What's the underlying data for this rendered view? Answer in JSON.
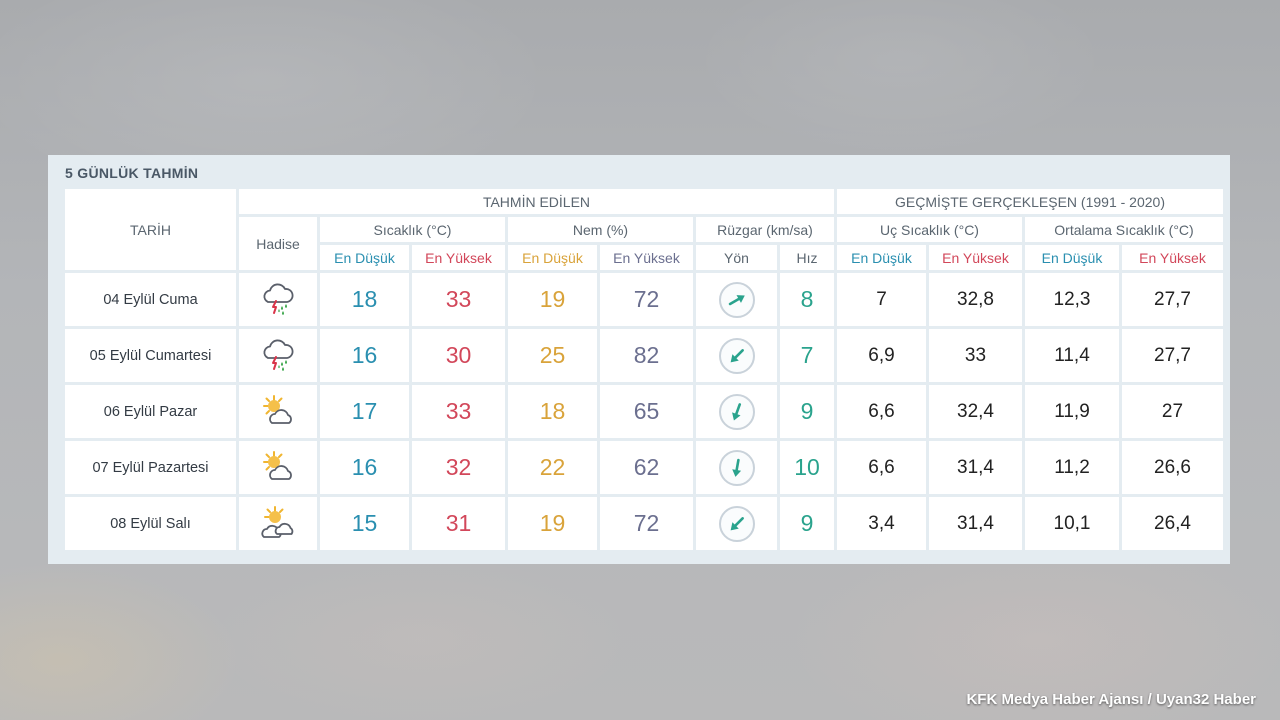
{
  "panel": {
    "title": "5 GÜNLÜK TAHMİN"
  },
  "header": {
    "date_col": "TARİH",
    "forecast_group": "TAHMİN EDİLEN",
    "history_group": "GEÇMİŞTE GERÇEKLEŞEN (1991 - 2020)",
    "event": "Hadise",
    "temperature": "Sıcaklık (°C)",
    "humidity": "Nem (%)",
    "wind": "Rüzgar (km/sa)",
    "extreme_temp": "Uç Sıcaklık (°C)",
    "average_temp": "Ortalama Sıcaklık (°C)",
    "low": "En Düşük",
    "high": "En Yüksek",
    "direction": "Yön",
    "speed": "Hız"
  },
  "rows": [
    {
      "date": "04 Eylül Cuma",
      "icon": "thunderstorm-rain-icon",
      "temp_low": "18",
      "temp_high": "33",
      "hum_low": "19",
      "hum_high": "72",
      "wind_dir_deg": 60,
      "wind_speed": "8",
      "ext_low": "7",
      "ext_high": "32,8",
      "avg_low": "12,3",
      "avg_high": "27,7"
    },
    {
      "date": "05 Eylül Cumartesi",
      "icon": "thunderstorm-rain-icon",
      "temp_low": "16",
      "temp_high": "30",
      "hum_low": "25",
      "hum_high": "82",
      "wind_dir_deg": 225,
      "wind_speed": "7",
      "ext_low": "6,9",
      "ext_high": "33",
      "avg_low": "11,4",
      "avg_high": "27,7"
    },
    {
      "date": "06 Eylül Pazar",
      "icon": "partly-sunny-icon",
      "temp_low": "17",
      "temp_high": "33",
      "hum_low": "18",
      "hum_high": "65",
      "wind_dir_deg": 200,
      "wind_speed": "9",
      "ext_low": "6,6",
      "ext_high": "32,4",
      "avg_low": "11,9",
      "avg_high": "27"
    },
    {
      "date": "07 Eylül Pazartesi",
      "icon": "partly-sunny-icon",
      "temp_low": "16",
      "temp_high": "32",
      "hum_low": "22",
      "hum_high": "62",
      "wind_dir_deg": 190,
      "wind_speed": "10",
      "ext_low": "6,6",
      "ext_high": "31,4",
      "avg_low": "11,2",
      "avg_high": "26,6"
    },
    {
      "date": "08 Eylül Salı",
      "icon": "partly-cloudy-icon",
      "temp_low": "15",
      "temp_high": "31",
      "hum_low": "19",
      "hum_high": "72",
      "wind_dir_deg": 225,
      "wind_speed": "9",
      "ext_low": "3,4",
      "ext_high": "31,4",
      "avg_low": "10,1",
      "avg_high": "26,4"
    }
  ],
  "colors": {
    "low": "#2a8fb0",
    "high": "#d2475a",
    "humidity_low": "#d9a33a",
    "humidity_high": "#6b6f8f",
    "wind": "#2aa38d"
  },
  "watermark": "KFK Medya Haber Ajansı / Uyan32 Haber"
}
